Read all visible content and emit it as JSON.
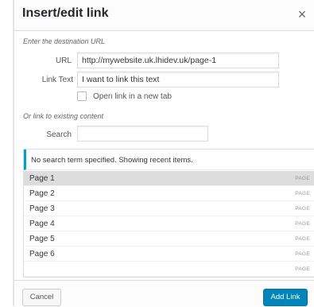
{
  "dialog": {
    "title": "Insert/edit link",
    "close_icon": "×"
  },
  "url_section": {
    "heading": "Enter the destination URL",
    "url_label": "URL",
    "url_value": "http://mywebsite.uk.lhidev.uk/page-1",
    "link_text_label": "Link Text",
    "link_text_value": "I want to link this text",
    "new_tab_label": "Open link in a new tab",
    "new_tab_checked": false
  },
  "existing_section": {
    "heading": "Or link to existing content",
    "search_label": "Search",
    "search_value": ""
  },
  "results": {
    "notice": "No search term specified. Showing recent items.",
    "items": [
      {
        "title": "Page 1",
        "type": "PAGE",
        "selected": true
      },
      {
        "title": "Page 2",
        "type": "PAGE",
        "selected": false
      },
      {
        "title": "Page 3",
        "type": "PAGE",
        "selected": false
      },
      {
        "title": "Page 4",
        "type": "PAGE",
        "selected": false
      },
      {
        "title": "Page 5",
        "type": "PAGE",
        "selected": false
      },
      {
        "title": "Page 6",
        "type": "PAGE",
        "selected": false
      },
      {
        "title": "",
        "type": "PAGE",
        "selected": false
      }
    ]
  },
  "footer": {
    "cancel_label": "Cancel",
    "add_link_label": "Add Link"
  },
  "colors": {
    "accent": "#00a0d2",
    "primary_button": "#0085ba",
    "selected_row": "#dddddd"
  }
}
